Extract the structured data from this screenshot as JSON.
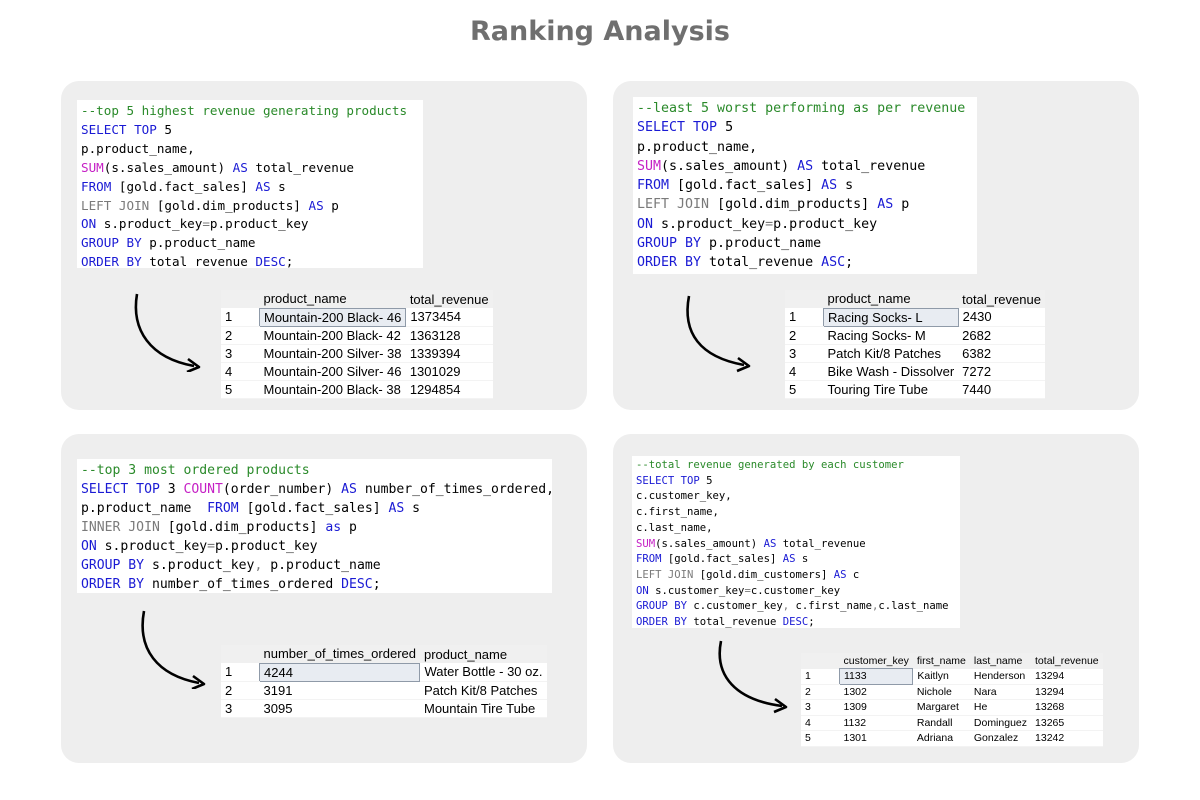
{
  "page_title": "Ranking Analysis",
  "panels": [
    {
      "code_lines": [
        [
          [
            "cm",
            "--top 5 highest revenue generating products"
          ]
        ],
        [
          [
            "kw",
            "SELECT TOP "
          ],
          [
            "pl",
            "5"
          ]
        ],
        [
          [
            "pl",
            "p.product_name,"
          ]
        ],
        [
          [
            "fn",
            "SUM"
          ],
          [
            "pl",
            "(s.sales_amount) "
          ],
          [
            "kw",
            "AS"
          ],
          [
            "pl",
            " total_revenue"
          ]
        ],
        [
          [
            "kw",
            "FROM"
          ],
          [
            "pl",
            " [gold.fact_sales] "
          ],
          [
            "kw",
            "AS"
          ],
          [
            "pl",
            " s"
          ]
        ],
        [
          [
            "gr",
            "LEFT JOIN"
          ],
          [
            "pl",
            " [gold.dim_products] "
          ],
          [
            "kw",
            "AS"
          ],
          [
            "pl",
            " p"
          ]
        ],
        [
          [
            "kw",
            "ON"
          ],
          [
            "pl",
            " s.product_key"
          ],
          [
            "gr",
            "="
          ],
          [
            "pl",
            "p.product_key"
          ]
        ],
        [
          [
            "kw",
            "GROUP BY"
          ],
          [
            "pl",
            " p.product_name"
          ]
        ],
        [
          [
            "kw",
            "ORDER BY"
          ],
          [
            "pl",
            " total_revenue "
          ],
          [
            "kw",
            "DESC"
          ],
          [
            "pl",
            ";"
          ]
        ]
      ],
      "table": {
        "headers": [
          "",
          "product_name",
          "total_revenue"
        ],
        "rows": [
          [
            "1",
            "Mountain-200 Black- 46",
            "1373454"
          ],
          [
            "2",
            "Mountain-200 Black- 42",
            "1363128"
          ],
          [
            "3",
            "Mountain-200 Silver- 38",
            "1339394"
          ],
          [
            "4",
            "Mountain-200 Silver- 46",
            "1301029"
          ],
          [
            "5",
            "Mountain-200 Black- 38",
            "1294854"
          ]
        ]
      }
    },
    {
      "code_lines": [
        [
          [
            "cm",
            "--least 5 worst performing as per revenue"
          ]
        ],
        [
          [
            "kw",
            "SELECT TOP "
          ],
          [
            "pl",
            "5"
          ]
        ],
        [
          [
            "pl",
            "p.product_name,"
          ]
        ],
        [
          [
            "fn",
            "SUM"
          ],
          [
            "pl",
            "(s.sales_amount) "
          ],
          [
            "kw",
            "AS"
          ],
          [
            "pl",
            " total_revenue"
          ]
        ],
        [
          [
            "kw",
            "FROM"
          ],
          [
            "pl",
            " [gold.fact_sales] "
          ],
          [
            "kw",
            "AS"
          ],
          [
            "pl",
            " s"
          ]
        ],
        [
          [
            "gr",
            "LEFT JOIN"
          ],
          [
            "pl",
            " [gold.dim_products] "
          ],
          [
            "kw",
            "AS"
          ],
          [
            "pl",
            " p"
          ]
        ],
        [
          [
            "kw",
            "ON"
          ],
          [
            "pl",
            " s.product_key"
          ],
          [
            "gr",
            "="
          ],
          [
            "pl",
            "p.product_key"
          ]
        ],
        [
          [
            "kw",
            "GROUP BY"
          ],
          [
            "pl",
            " p.product_name"
          ]
        ],
        [
          [
            "kw",
            "ORDER BY"
          ],
          [
            "pl",
            " total_revenue "
          ],
          [
            "kw",
            "ASC"
          ],
          [
            "pl",
            ";"
          ]
        ]
      ],
      "table": {
        "headers": [
          "",
          "product_name",
          "total_revenue"
        ],
        "rows": [
          [
            "1",
            "Racing Socks- L",
            "2430"
          ],
          [
            "2",
            "Racing Socks- M",
            "2682"
          ],
          [
            "3",
            "Patch Kit/8 Patches",
            "6382"
          ],
          [
            "4",
            "Bike Wash - Dissolver",
            "7272"
          ],
          [
            "5",
            "Touring Tire Tube",
            "7440"
          ]
        ]
      }
    },
    {
      "code_lines": [
        [
          [
            "cm",
            "--top 3 most ordered products"
          ]
        ],
        [
          [
            "kw",
            "SELECT TOP "
          ],
          [
            "pl",
            "3 "
          ],
          [
            "fn",
            "COUNT"
          ],
          [
            "pl",
            "(order_number) "
          ],
          [
            "kw",
            "AS"
          ],
          [
            "pl",
            " number_of_times_ordered,"
          ]
        ],
        [
          [
            "pl",
            "p.product_name  "
          ],
          [
            "kw",
            "FROM"
          ],
          [
            "pl",
            " [gold.fact_sales] "
          ],
          [
            "kw",
            "AS"
          ],
          [
            "pl",
            " s"
          ]
        ],
        [
          [
            "gr",
            "INNER JOIN"
          ],
          [
            "pl",
            " [gold.dim_products] "
          ],
          [
            "kw",
            "as"
          ],
          [
            "pl",
            " p"
          ]
        ],
        [
          [
            "kw",
            "ON"
          ],
          [
            "pl",
            " s.product_key"
          ],
          [
            "gr",
            "="
          ],
          [
            "pl",
            "p.product_key"
          ]
        ],
        [
          [
            "kw",
            "GROUP BY"
          ],
          [
            "pl",
            " s.product_key"
          ],
          [
            "gr",
            ","
          ],
          [
            "pl",
            " p.product_name"
          ]
        ],
        [
          [
            "kw",
            "ORDER BY"
          ],
          [
            "pl",
            " number_of_times_ordered "
          ],
          [
            "kw",
            "DESC"
          ],
          [
            "pl",
            ";"
          ]
        ]
      ],
      "table": {
        "headers": [
          "",
          "number_of_times_ordered",
          "product_name"
        ],
        "rows": [
          [
            "1",
            "4244",
            "Water Bottle - 30 oz."
          ],
          [
            "2",
            "3191",
            "Patch Kit/8 Patches"
          ],
          [
            "3",
            "3095",
            "Mountain Tire Tube"
          ]
        ]
      }
    },
    {
      "code_lines": [
        [
          [
            "cm",
            "--total revenue generated by each customer"
          ]
        ],
        [
          [
            "kw",
            "SELECT TOP "
          ],
          [
            "pl",
            "5"
          ]
        ],
        [
          [
            "pl",
            "c.customer_key,"
          ]
        ],
        [
          [
            "pl",
            "c.first_name,"
          ]
        ],
        [
          [
            "pl",
            "c.last_name,"
          ]
        ],
        [
          [
            "fn",
            "SUM"
          ],
          [
            "pl",
            "(s.sales_amount) "
          ],
          [
            "kw",
            "AS"
          ],
          [
            "pl",
            " total_revenue"
          ]
        ],
        [
          [
            "kw",
            "FROM"
          ],
          [
            "pl",
            " [gold.fact_sales] "
          ],
          [
            "kw",
            "AS"
          ],
          [
            "pl",
            " s"
          ]
        ],
        [
          [
            "gr",
            "LEFT JOIN"
          ],
          [
            "pl",
            " [gold.dim_customers] "
          ],
          [
            "kw",
            "AS"
          ],
          [
            "pl",
            " c"
          ]
        ],
        [
          [
            "kw",
            "ON"
          ],
          [
            "pl",
            " s.customer_key"
          ],
          [
            "gr",
            "="
          ],
          [
            "pl",
            "c.customer_key"
          ]
        ],
        [
          [
            "kw",
            "GROUP BY"
          ],
          [
            "pl",
            " c.customer_key"
          ],
          [
            "gr",
            ","
          ],
          [
            "pl",
            " c.first_name"
          ],
          [
            "gr",
            ","
          ],
          [
            "pl",
            "c.last_name"
          ]
        ],
        [
          [
            "kw",
            "ORDER BY"
          ],
          [
            "pl",
            " total_revenue "
          ],
          [
            "kw",
            "DESC"
          ],
          [
            "pl",
            ";"
          ]
        ]
      ],
      "table": {
        "headers": [
          "",
          "customer_key",
          "first_name",
          "last_name",
          "total_revenue"
        ],
        "rows": [
          [
            "1",
            "1133",
            "Kaitlyn",
            "Henderson",
            "13294"
          ],
          [
            "2",
            "1302",
            "Nichole",
            "Nara",
            "13294"
          ],
          [
            "3",
            "1309",
            "Margaret",
            "He",
            "13268"
          ],
          [
            "4",
            "1132",
            "Randall",
            "Dominguez",
            "13265"
          ],
          [
            "5",
            "1301",
            "Adriana",
            "Gonzalez",
            "13242"
          ]
        ]
      }
    }
  ]
}
